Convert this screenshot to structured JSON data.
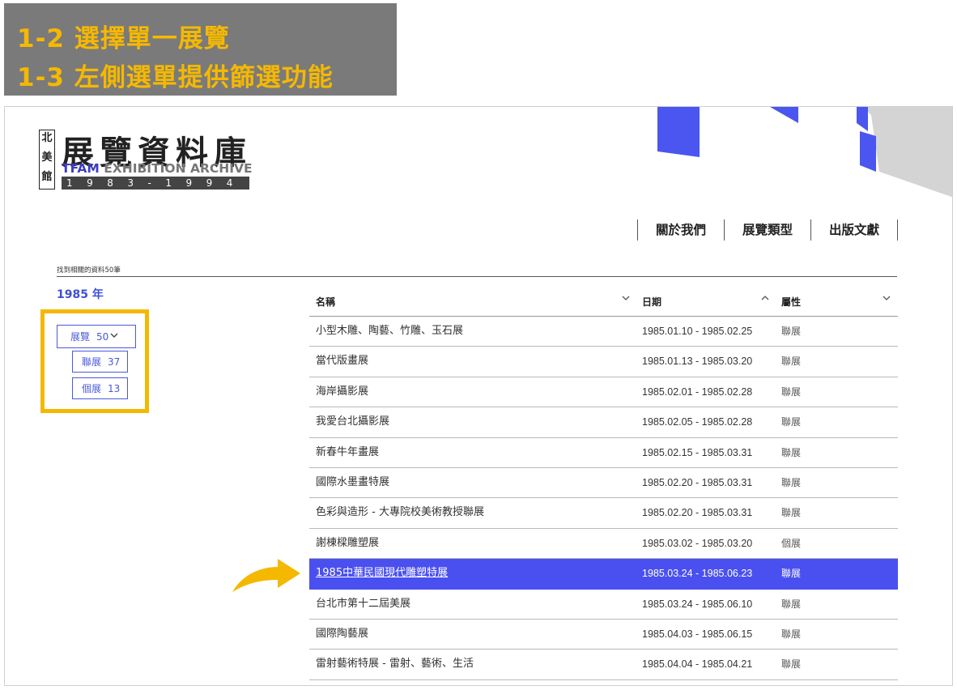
{
  "banner": {
    "line1": "1-2 選擇單一展覽",
    "line2": "1-3 左側選單提供篩選功能"
  },
  "logo": {
    "vertical": [
      "北",
      "美",
      "館"
    ],
    "title": "展覽資料庫",
    "subtitle_tfam": "TFAM",
    "subtitle_rest": " EXHIBITION ARCHIVE",
    "years": "1983-1994"
  },
  "nav": [
    {
      "label": "關於我們"
    },
    {
      "label": "展覽類型"
    },
    {
      "label": "出版文獻"
    }
  ],
  "results_text": "找到相關的資料50筆",
  "year_heading": "1985 年",
  "filters": {
    "main": {
      "label": "展覽",
      "count": "50"
    },
    "sub": [
      {
        "label": "聯展",
        "count": "37"
      },
      {
        "label": "個展",
        "count": "13"
      }
    ]
  },
  "table": {
    "headers": {
      "name": "名稱",
      "date": "日期",
      "type": "屬性"
    },
    "rows": [
      {
        "name": "小型木雕、陶藝、竹雕、玉石展",
        "date": "1985.01.10 - 1985.02.25",
        "type": "聯展"
      },
      {
        "name": "當代版畫展",
        "date": "1985.01.13 - 1985.03.20",
        "type": "聯展"
      },
      {
        "name": "海岸攝影展",
        "date": "1985.02.01 - 1985.02.28",
        "type": "聯展"
      },
      {
        "name": "我愛台北攝影展",
        "date": "1985.02.05 - 1985.02.28",
        "type": "聯展"
      },
      {
        "name": "新春牛年畫展",
        "date": "1985.02.15 - 1985.03.31",
        "type": "聯展"
      },
      {
        "name": "國際水墨畫特展",
        "date": "1985.02.20 - 1985.03.31",
        "type": "聯展"
      },
      {
        "name": "色彩與造形 - 大專院校美術教授聯展",
        "date": "1985.02.20 - 1985.03.31",
        "type": "聯展"
      },
      {
        "name": "謝棟樑雕塑展",
        "date": "1985.03.02 - 1985.03.20",
        "type": "個展"
      },
      {
        "name": "1985中華民國現代雕塑特展",
        "date": "1985.03.24 - 1985.06.23",
        "type": "聯展",
        "selected": true
      },
      {
        "name": "台北市第十二屆美展",
        "date": "1985.03.24 - 1985.06.10",
        "type": "聯展"
      },
      {
        "name": "國際陶藝展",
        "date": "1985.04.03 - 1985.06.15",
        "type": "聯展"
      },
      {
        "name": "雷射藝術特展 - 雷射、藝術、生活",
        "date": "1985.04.04 - 1985.04.21",
        "type": "聯展"
      }
    ]
  },
  "colors": {
    "accent": "#4a50ef",
    "highlight": "#f5b800",
    "banner_bg": "#7a7a7a"
  }
}
